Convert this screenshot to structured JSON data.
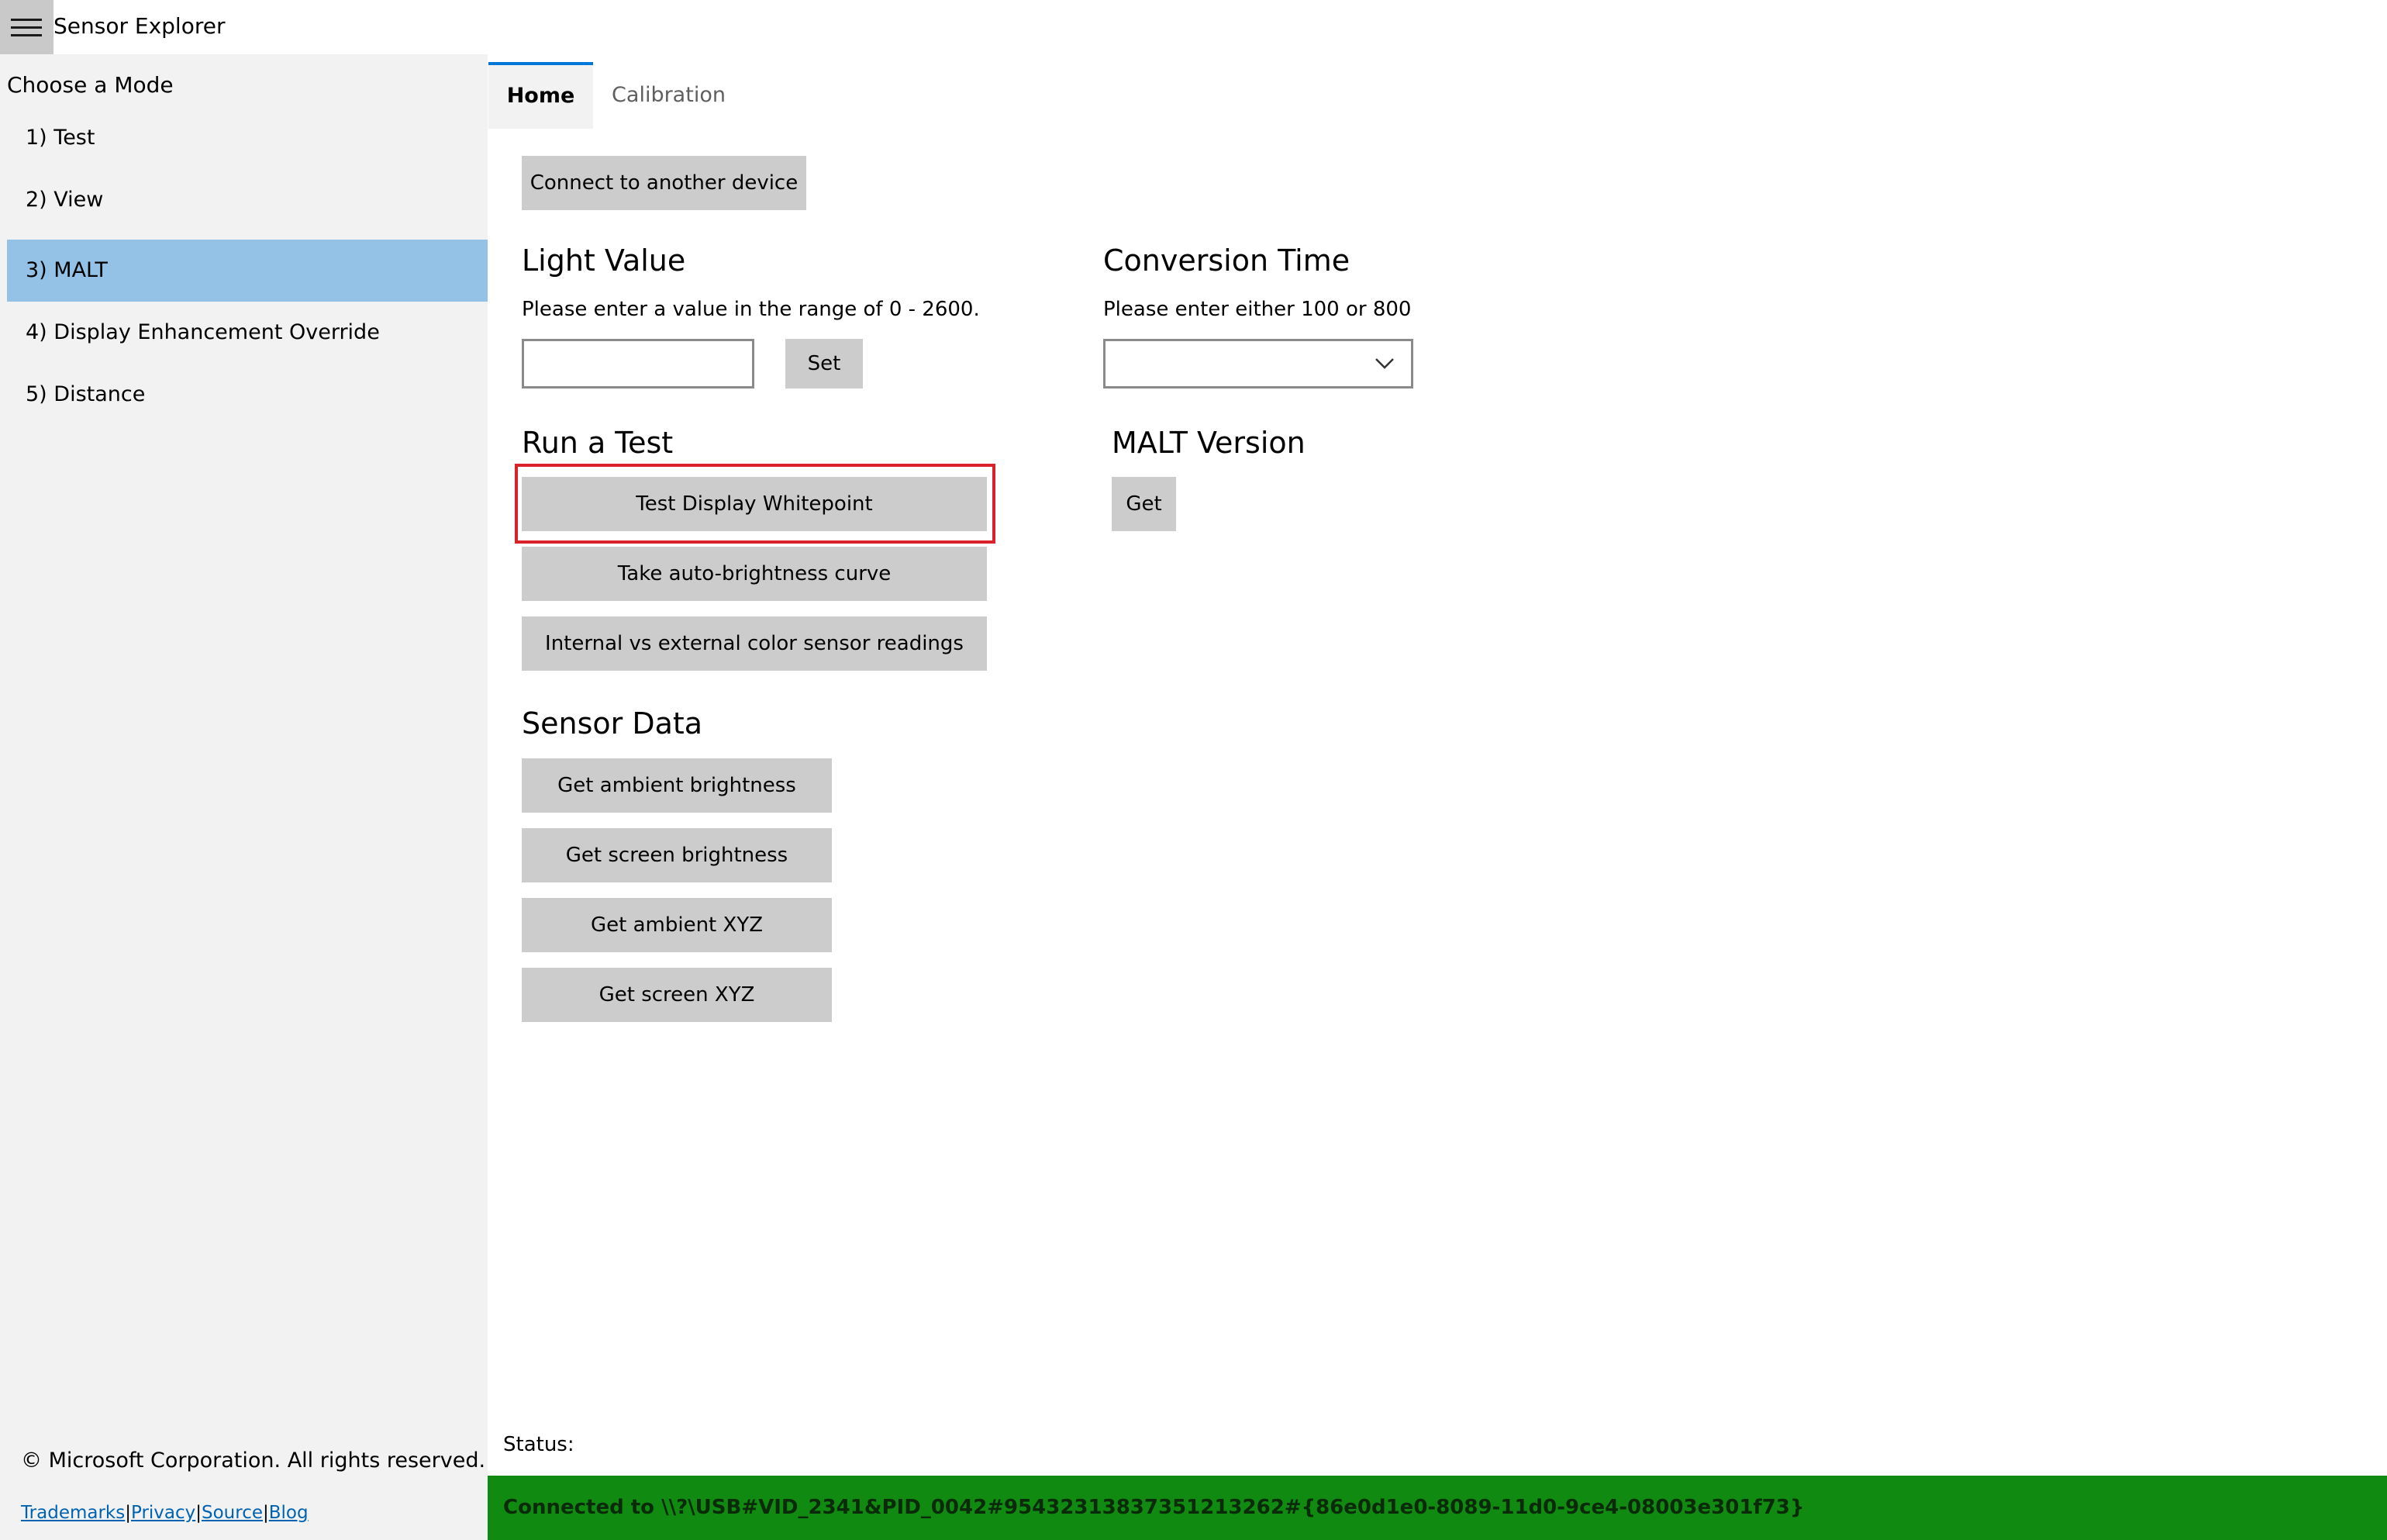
{
  "app": {
    "title": "Sensor Explorer",
    "menu_icon": "hamburger-menu-icon"
  },
  "sidebar": {
    "heading": "Choose a Mode",
    "items": [
      {
        "label": "1) Test",
        "selected": false
      },
      {
        "label": "2) View",
        "selected": false
      },
      {
        "label": "3) MALT",
        "selected": true
      },
      {
        "label": "4) Display Enhancement Override",
        "selected": false
      },
      {
        "label": "5) Distance",
        "selected": false
      }
    ],
    "selected_color": "#93c2e6",
    "copyright": "© Microsoft Corporation. All rights reserved.",
    "links": [
      "Trademarks",
      "Privacy",
      "Source",
      "Blog"
    ],
    "link_separator": "|"
  },
  "tabs": [
    {
      "label": "Home",
      "active": true
    },
    {
      "label": "Calibration",
      "active": false
    }
  ],
  "main": {
    "connect_button": "Connect to another device",
    "light_value": {
      "heading": "Light Value",
      "hint": "Please enter a value in the range of 0 - 2600.",
      "input_value": "",
      "set_button": "Set"
    },
    "conversion_time": {
      "heading": "Conversion Time",
      "hint": "Please enter either 100 or 800",
      "selected_value": "",
      "dropdown_icon": "chevron-down-icon"
    },
    "run_test": {
      "heading": "Run a Test",
      "buttons": [
        "Test Display Whitepoint",
        "Take auto-brightness curve",
        "Internal vs external color sensor readings"
      ],
      "highlight_color": "#d9222a"
    },
    "malt_version": {
      "heading": "MALT Version",
      "get_button": "Get"
    },
    "sensor_data": {
      "heading": "Sensor Data",
      "buttons": [
        "Get ambient brightness",
        "Get screen brightness",
        "Get ambient XYZ",
        "Get screen XYZ"
      ]
    }
  },
  "status": {
    "label": "Status:",
    "message": "Connected to \\\\?\\USB#VID_2341&PID_0042#95432313837351213262#{86e0d1e0-8089-11d0-9ce4-08003e301f73}",
    "bar_color": "#108a10"
  }
}
